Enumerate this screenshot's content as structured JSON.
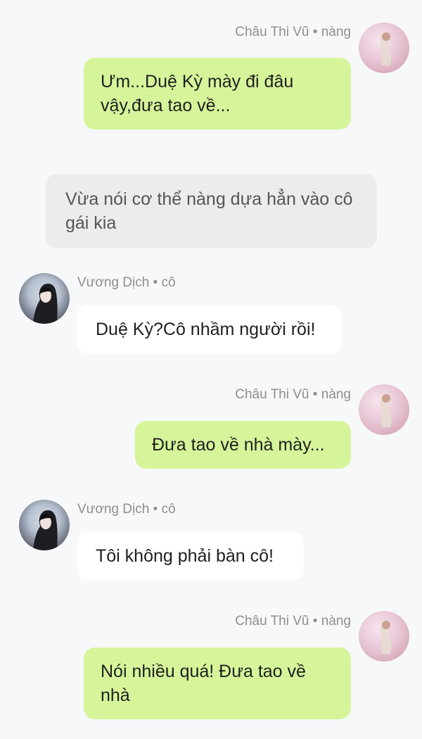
{
  "messages": [
    {
      "sender": "Châu Thi Vũ",
      "role": "nàng",
      "side": "right",
      "text": "Ưm...Duệ Kỳ mày đi đâu vậy,đưa tao về..."
    },
    {
      "sender": "",
      "role": "",
      "side": "narration",
      "text": "Vừa nói cơ thể nàng dựa hẳn vào cô gái kia"
    },
    {
      "sender": "Vương Dịch",
      "role": "cô",
      "side": "left",
      "text": "Duệ Kỳ?Cô nhầm người rồi!"
    },
    {
      "sender": "Châu Thi Vũ",
      "role": "nàng",
      "side": "right",
      "text": "Đưa tao về nhà mày..."
    },
    {
      "sender": "Vương Dịch",
      "role": "cô",
      "side": "left",
      "text": "Tôi không phải bàn cô!"
    },
    {
      "sender": "Châu Thi Vũ",
      "role": "nàng",
      "side": "right",
      "text": "Nói nhiều quá! Đưa tao về nhà"
    }
  ],
  "separator": " • ",
  "colors": {
    "background": "#f7f8fa",
    "self_bubble": "#d6f59a",
    "other_bubble": "#ffffff",
    "narration_bubble": "#ececec",
    "meta_text": "#8e8e8e"
  }
}
